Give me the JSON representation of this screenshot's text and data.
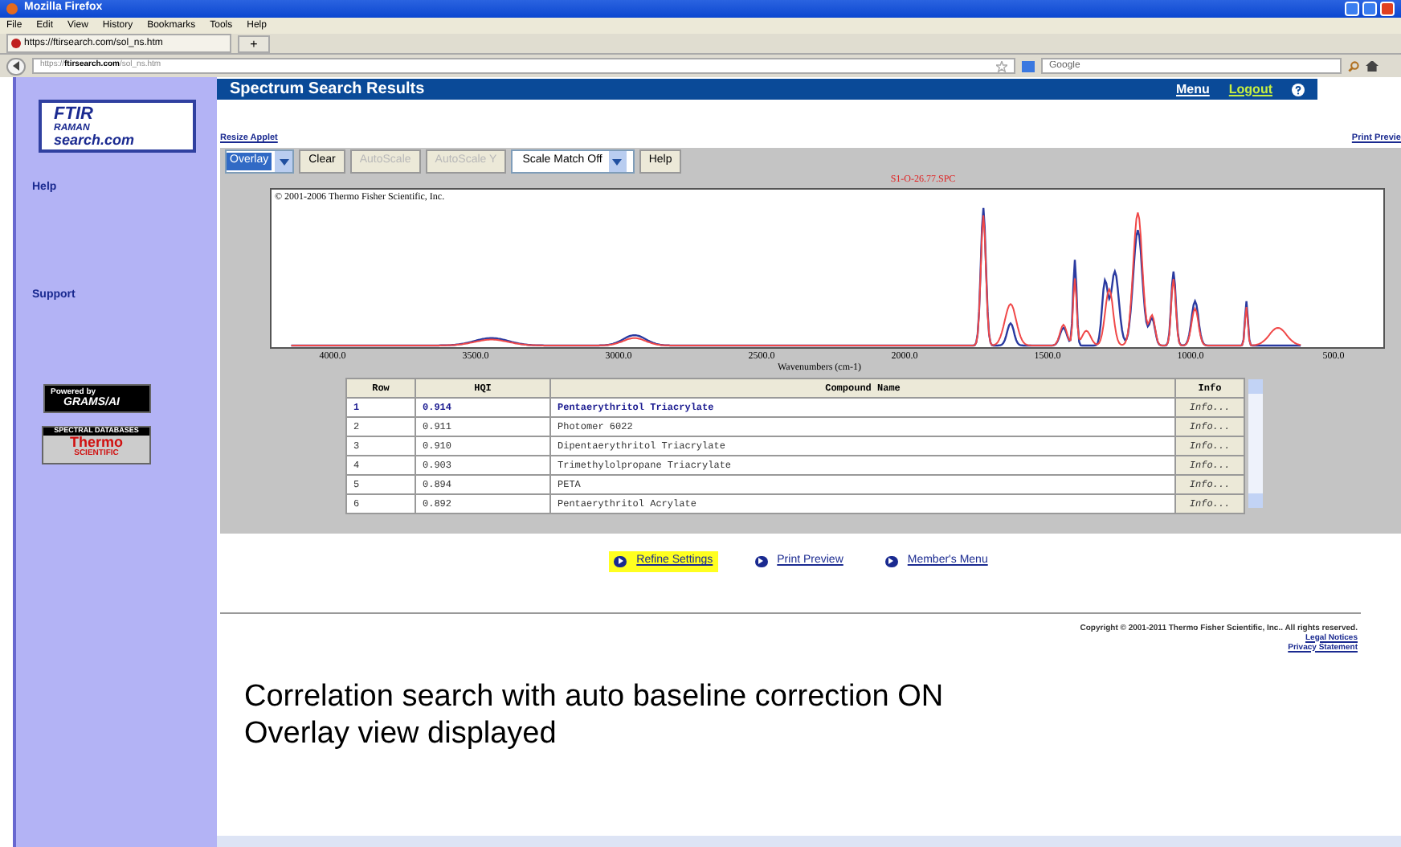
{
  "window": {
    "title": "Mozilla Firefox"
  },
  "menu": [
    "File",
    "Edit",
    "View",
    "History",
    "Bookmarks",
    "Tools",
    "Help"
  ],
  "tab": {
    "title": "https://ftirsearch.com/sol_ns.htm",
    "new_tab": "+"
  },
  "address": {
    "prefix": "https://",
    "host": "ftirsearch.com",
    "path": "/sol_ns.htm"
  },
  "search": {
    "placeholder": "Google"
  },
  "logo": {
    "line_1": "FTIR",
    "line_2": "RAMAN",
    "line_3": "search.com"
  },
  "sidebar": {
    "items": [
      "Help",
      "Support"
    ],
    "badges": [
      {
        "kind": "grams",
        "top": "Powered by",
        "main": "GRAMS/AI"
      },
      {
        "kind": "thermo",
        "top": "SPECTRAL DATABASES",
        "main": "Thermo",
        "sub": "SCIENTIFIC"
      }
    ]
  },
  "header": {
    "title": "Spectrum Search Results",
    "links": [
      {
        "label": "Menu",
        "kind": "plain"
      },
      {
        "label": "Logout",
        "kind": "accent"
      }
    ]
  },
  "applet_links": {
    "left": "Resize Applet",
    "right": "Print Previe"
  },
  "toolbar": [
    {
      "kind": "select",
      "label": "Overlay",
      "disabled": false
    },
    {
      "kind": "button",
      "label": "Clear",
      "disabled": false
    },
    {
      "kind": "button",
      "label": "AutoScale",
      "disabled": true
    },
    {
      "kind": "button",
      "label": "AutoScale Y",
      "disabled": true
    },
    {
      "kind": "select",
      "label": "Scale Match Off",
      "disabled": false
    },
    {
      "kind": "button",
      "label": "Help",
      "disabled": false
    }
  ],
  "spectrum": {
    "title": "S1-O-26.77.SPC",
    "copyright": "© 2001-2006 Thermo Fisher Scientific, Inc.",
    "xlabel": "Wavenumbers (cm-1)",
    "xticks": [
      "4000.0",
      "3500.0",
      "3000.0",
      "2500.0",
      "2000.0",
      "1500.0",
      "1000.0",
      "500.0"
    ]
  },
  "table": {
    "columns": [
      "Row",
      "HQI",
      "Compound Name",
      "Info"
    ],
    "rows": [
      {
        "row": "1",
        "hqi": "0.914",
        "name": "Pentaerythritol Triacrylate",
        "info": "Info...",
        "selected": true
      },
      {
        "row": "2",
        "hqi": "0.911",
        "name": "Photomer 6022",
        "info": "Info...",
        "selected": false
      },
      {
        "row": "3",
        "hqi": "0.910",
        "name": "Dipentaerythritol Triacrylate",
        "info": "Info...",
        "selected": false
      },
      {
        "row": "4",
        "hqi": "0.903",
        "name": "Trimethylolpropane Triacrylate",
        "info": "Info...",
        "selected": false
      },
      {
        "row": "5",
        "hqi": "0.894",
        "name": "PETA",
        "info": "Info...",
        "selected": false
      },
      {
        "row": "6",
        "hqi": "0.892",
        "name": "Pentaerythritol Acrylate",
        "info": "Info...",
        "selected": false
      }
    ]
  },
  "links": [
    {
      "label": "Refine Settings",
      "selected": true
    },
    {
      "label": "Print Preview",
      "selected": false
    },
    {
      "label": "Member's Menu",
      "selected": false
    }
  ],
  "footer": {
    "copyright": "Copyright © 2001-2011 Thermo Fisher Scientific, Inc.. All rights reserved.",
    "links": [
      "Legal Notices",
      "Privacy Statement"
    ]
  },
  "caption": [
    "Correlation search with auto baseline correction ON",
    "Overlay view displayed"
  ]
}
